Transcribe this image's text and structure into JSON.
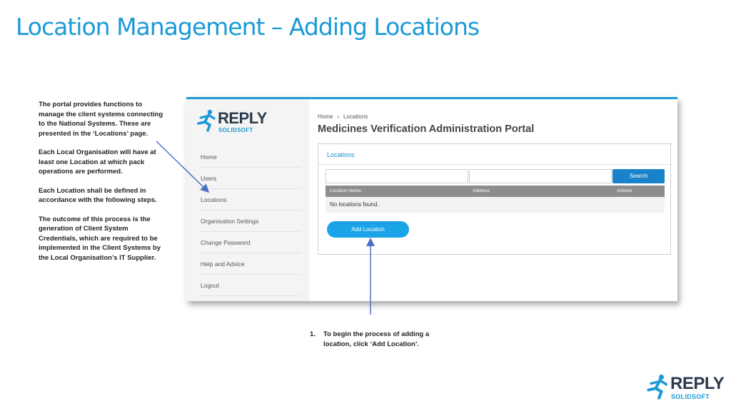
{
  "slide": {
    "title": "Location Management – Adding Locations",
    "notes": [
      "The portal provides functions to manage the client systems connecting to the National Systems. These are presented in the ‘Locations’ page.",
      "Each Local Organisation will have at least one Location at which pack operations are performed.",
      "Each Location shall be defined in accordance with the following steps.",
      "The outcome of this process is the generation of Client System Credentials, which are required to be implemented in the Client Systems by the Local Organisation’s IT Supplier."
    ],
    "step": {
      "number": "1.",
      "text": "To begin the process of adding a location, click ‘Add Location’."
    }
  },
  "brand": {
    "name": "REPLY",
    "sub": "SOLIDSOFT"
  },
  "portal": {
    "breadcrumb": {
      "home": "Home",
      "separator": "›",
      "current": "Locations"
    },
    "title": "Medicines Verification Administration Portal",
    "nav": [
      "Home",
      "Users",
      "Locations",
      "Organisation Settings",
      "Change Password",
      "Help and Advice",
      "Logout"
    ],
    "panel": {
      "title": "Locations",
      "search_label": "Search",
      "columns": [
        "Location Name",
        "Address",
        "Actions"
      ],
      "empty_message": "No locations found.",
      "add_label": "Add Location"
    }
  },
  "colors": {
    "accent": "#1a9ad7",
    "button": "#1a82c8",
    "add_button": "#1aa3e6",
    "arrow": "#4a72c4"
  },
  "icons": {
    "logo": "runner-figure-icon"
  }
}
